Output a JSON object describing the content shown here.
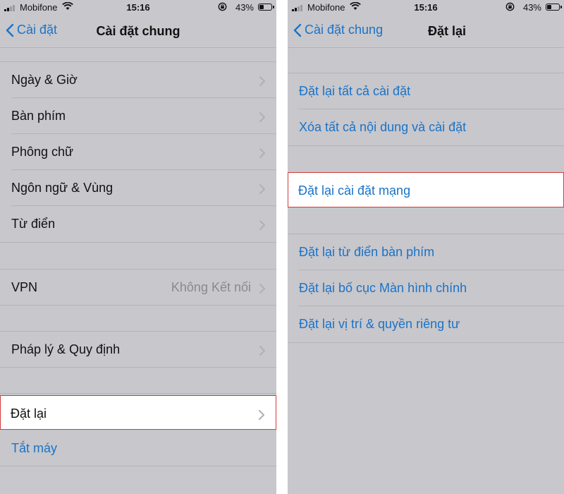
{
  "left": {
    "status": {
      "carrier": "Mobifone",
      "time": "15:16",
      "battery": "43%",
      "battery_level": 0.43
    },
    "nav": {
      "back_label": "Cài đặt",
      "title": "Cài đặt chung"
    },
    "groups": [
      {
        "rows": [
          {
            "label": "Ngày & Giờ"
          },
          {
            "label": "Bàn phím"
          },
          {
            "label": "Phông chữ"
          },
          {
            "label": "Ngôn ngữ & Vùng"
          },
          {
            "label": "Từ điển"
          }
        ]
      },
      {
        "rows": [
          {
            "label": "VPN",
            "detail": "Không Kết nối"
          }
        ]
      },
      {
        "rows": [
          {
            "label": "Pháp lý & Quy định"
          }
        ]
      },
      {
        "rows": [
          {
            "label": "Đặt lại",
            "highlighted": true
          },
          {
            "label": "Tắt máy"
          }
        ]
      }
    ]
  },
  "right": {
    "status": {
      "carrier": "Mobifone",
      "time": "15:16",
      "battery": "43%",
      "battery_level": 0.43
    },
    "nav": {
      "back_label": "Cài đặt chung",
      "title": "Đặt lại"
    },
    "groups": [
      {
        "rows": [
          {
            "label": "Đặt lại tất cả cài đặt"
          },
          {
            "label": "Xóa tất cả nội dung và cài đặt"
          }
        ]
      },
      {
        "rows": [
          {
            "label": "Đặt lại cài đặt mạng",
            "highlighted": true
          }
        ]
      },
      {
        "rows": [
          {
            "label": "Đặt lại từ điển bàn phím"
          },
          {
            "label": "Đặt lại bố cục Màn hình chính"
          },
          {
            "label": "Đặt lại vị trí & quyền riêng tư"
          }
        ]
      }
    ]
  },
  "colors": {
    "accent": "#1a73c8",
    "highlight_border": "#d23a3a",
    "background": "#c8c7cc"
  },
  "icons": {
    "back": "chevron-left-icon",
    "disclosure": "chevron-right-icon",
    "wifi": "wifi-icon",
    "orientation_lock": "orientation-lock-icon",
    "battery": "battery-icon",
    "signal": "cellular-signal-icon"
  }
}
